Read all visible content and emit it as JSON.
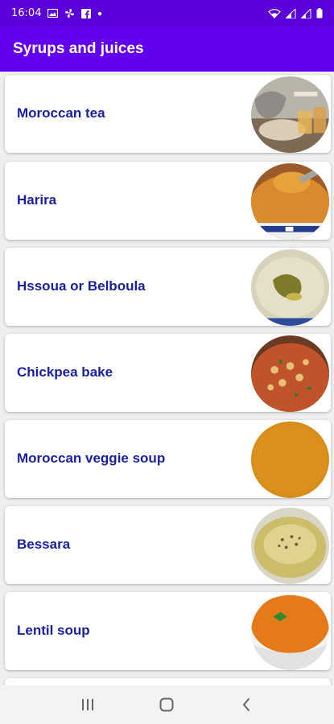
{
  "status_bar": {
    "time": "16:04",
    "icons_left": [
      "gallery-icon",
      "fan-icon",
      "facebook-icon",
      "dot-icon"
    ],
    "icons_right": [
      "wifi-icon",
      "signal-icon",
      "signal-icon",
      "battery-icon"
    ]
  },
  "app_bar": {
    "title": "Syrups and juices"
  },
  "recipes": [
    {
      "label": "Moroccan tea",
      "image": "moroccan-tea-photo"
    },
    {
      "label": "Harira",
      "image": "harira-soup-photo"
    },
    {
      "label": "Hssoua or Belboula",
      "image": "hssoua-soup-photo"
    },
    {
      "label": "Chickpea bake",
      "image": "chickpea-bake-photo"
    },
    {
      "label": "Moroccan veggie soup",
      "image": "veggie-soup-photo"
    },
    {
      "label": "Bessara",
      "image": "bessara-photo"
    },
    {
      "label": "Lentil soup",
      "image": "lentil-soup-photo"
    }
  ],
  "nav_bar": {
    "buttons": [
      "recent-apps-icon",
      "home-icon",
      "back-icon"
    ]
  },
  "colors": {
    "status_bar": "#5a00d8",
    "app_bar": "#6200ee",
    "item_text": "#1a1fa0"
  }
}
